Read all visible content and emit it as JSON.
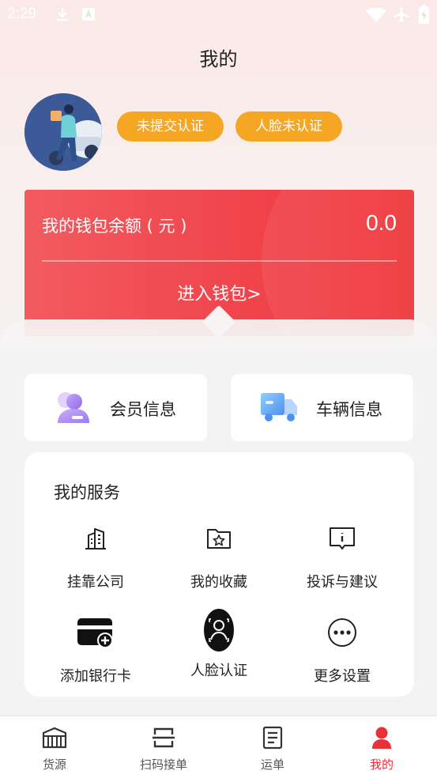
{
  "status_bar": {
    "time": "2:29"
  },
  "header": {
    "title": "我的"
  },
  "profile": {
    "badges": [
      "未提交认证",
      "人脸未认证"
    ]
  },
  "wallet": {
    "label": "我的钱包余额 ( 元 )",
    "amount": "0.0",
    "link": "进入钱包>"
  },
  "cards": [
    {
      "label": "会员信息",
      "icon": "member-icon"
    },
    {
      "label": "车辆信息",
      "icon": "truck-icon"
    }
  ],
  "services": {
    "title": "我的服务",
    "items": [
      {
        "label": "挂靠公司",
        "icon": "building-icon"
      },
      {
        "label": "我的收藏",
        "icon": "folder-star-icon"
      },
      {
        "label": "投诉与建议",
        "icon": "feedback-icon"
      },
      {
        "label": "添加银行卡",
        "icon": "add-card-icon"
      },
      {
        "label": "人脸认证",
        "icon": "face-scan-icon"
      },
      {
        "label": "更多设置",
        "icon": "more-icon"
      }
    ]
  },
  "bottom_nav": {
    "items": [
      {
        "label": "货源",
        "icon": "warehouse-icon"
      },
      {
        "label": "扫码接单",
        "icon": "scan-icon"
      },
      {
        "label": "运单",
        "icon": "waybill-icon"
      },
      {
        "label": "我的",
        "icon": "user-icon",
        "active": true
      }
    ]
  },
  "colors": {
    "accent": "#e8323a",
    "badge": "#f5a623",
    "wallet_bg": "#f0454c"
  }
}
